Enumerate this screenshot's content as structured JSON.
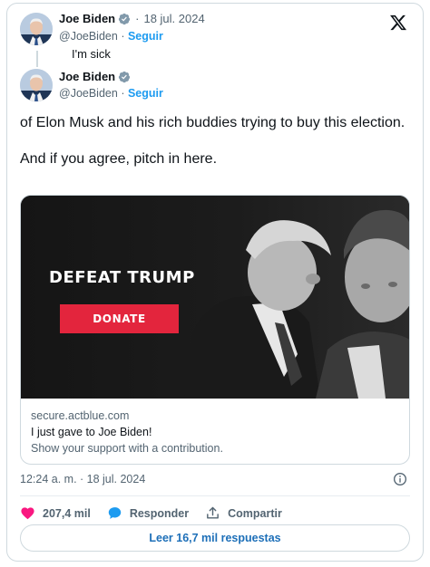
{
  "parent_tweet": {
    "author_name": "Joe Biden",
    "date": "18 jul. 2024",
    "handle": "@JoeBiden",
    "follow_label": "Seguir",
    "text": "I'm sick"
  },
  "main_tweet": {
    "author_name": "Joe Biden",
    "handle": "@JoeBiden",
    "follow_label": "Seguir",
    "text_line1": "of Elon Musk and his rich buddies trying to buy this election.",
    "text_line2": "And if you agree, pitch in here."
  },
  "link_card": {
    "ad_headline": "DEFEAT TRUMP",
    "ad_button": "DONATE",
    "domain": "secure.actblue.com",
    "title": "I just gave to Joe Biden!",
    "description": "Show your support with a contribution."
  },
  "timestamp": "12:24 a. m. · 18 jul. 2024",
  "actions": {
    "likes": "207,4 mil",
    "reply_label": "Responder",
    "share_label": "Compartir"
  },
  "read_replies_label": "Leer 16,7 mil respuestas",
  "colors": {
    "accent": "#1d9bf0",
    "like": "#f91880",
    "donate": "#e3253d"
  },
  "icons": [
    "verified-badge-icon",
    "x-logo-icon",
    "info-icon",
    "heart-icon",
    "reply-bubble-icon",
    "share-icon"
  ]
}
